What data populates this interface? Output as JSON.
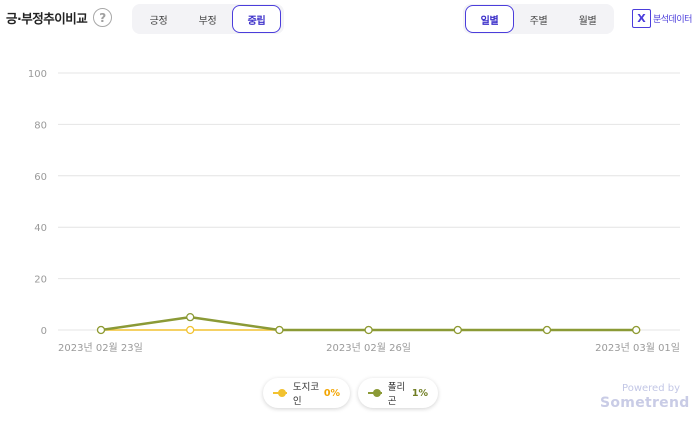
{
  "header": {
    "title": "긍·부정추이비교",
    "help_icon": "question-circle-icon",
    "sentiment_tabs": [
      {
        "label": "긍정",
        "active": false
      },
      {
        "label": "부정",
        "active": false
      },
      {
        "label": "중립",
        "active": true
      }
    ],
    "period_tabs": [
      {
        "label": "일별",
        "active": true
      },
      {
        "label": "주별",
        "active": false
      },
      {
        "label": "월별",
        "active": false
      }
    ],
    "export": {
      "icon": "excel-icon",
      "label": "분석데이터"
    }
  },
  "colors": {
    "accent": "#4b3ddb",
    "series_1": "#f2c230",
    "series_2": "#8b9a36",
    "grid": "#e4e4e4"
  },
  "chart_data": {
    "type": "line",
    "title": "",
    "xlabel": "",
    "ylabel": "",
    "ylim": [
      0,
      100
    ],
    "yticks": [
      0,
      20,
      40,
      60,
      80,
      100
    ],
    "grid": true,
    "x": [
      "2023-02-23",
      "2023-02-24",
      "2023-02-25",
      "2023-02-26",
      "2023-02-27",
      "2023-02-28",
      "2023-03-01"
    ],
    "x_tick_labels": [
      {
        "index": 0,
        "label": "2023년 02월 23일"
      },
      {
        "index": 3,
        "label": "2023년 02월 26일"
      },
      {
        "index": 6,
        "label": "2023년 03월 01일"
      }
    ],
    "series": [
      {
        "name": "도지코인",
        "color": "#f2c230",
        "values": [
          0,
          0,
          0,
          0,
          0,
          0,
          0
        ]
      },
      {
        "name": "폴리곤",
        "color": "#8b9a36",
        "values": [
          0,
          5,
          0,
          0,
          0,
          0,
          0
        ]
      }
    ],
    "legend_placement": "bottom"
  },
  "legend": [
    {
      "name": "도지코인",
      "pct": "0%",
      "color": "#f2c230"
    },
    {
      "name": "폴리곤",
      "pct": "1%",
      "color": "#8b9a36"
    }
  ],
  "branding": {
    "powered_by": "Powered by",
    "brand": "Sometrend"
  }
}
